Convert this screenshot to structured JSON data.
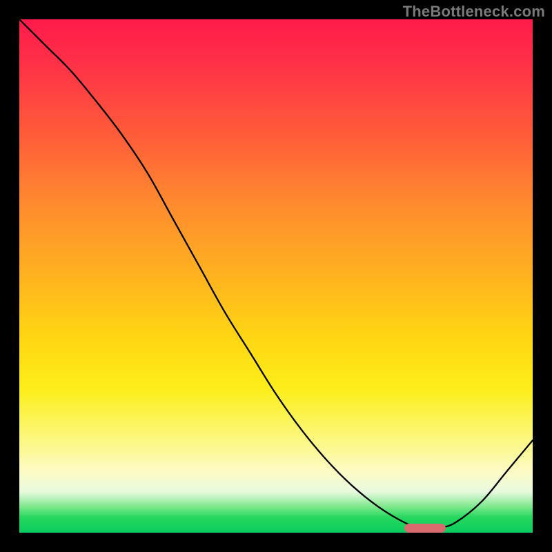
{
  "watermark_text": "TheBottleneck.com",
  "chart_data": {
    "type": "line",
    "title": "",
    "xlabel": "",
    "ylabel": "",
    "xlim": [
      0,
      100
    ],
    "ylim": [
      0,
      100
    ],
    "grid": false,
    "legend": null,
    "annotations": [],
    "series": [
      {
        "name": "bottleneck-curve",
        "x": [
          0,
          5,
          10,
          15,
          20,
          25,
          30,
          35,
          40,
          45,
          50,
          55,
          60,
          65,
          70,
          75,
          78,
          80,
          82,
          85,
          90,
          95,
          100
        ],
        "y": [
          100,
          95,
          90,
          84,
          77.5,
          70,
          61,
          52,
          43,
          35,
          27,
          20,
          14,
          9,
          5,
          2,
          1,
          1,
          1,
          2,
          6,
          12,
          18
        ]
      }
    ],
    "marker": {
      "x_start": 75,
      "x_end": 83,
      "y": 1,
      "color": "#d96b6f",
      "shape": "rounded-bar"
    },
    "background_gradient": {
      "top": "#ff1a4b",
      "bottom": "#0acb5f",
      "stops": [
        "red",
        "orange",
        "yellow",
        "pale-yellow",
        "green"
      ]
    }
  }
}
